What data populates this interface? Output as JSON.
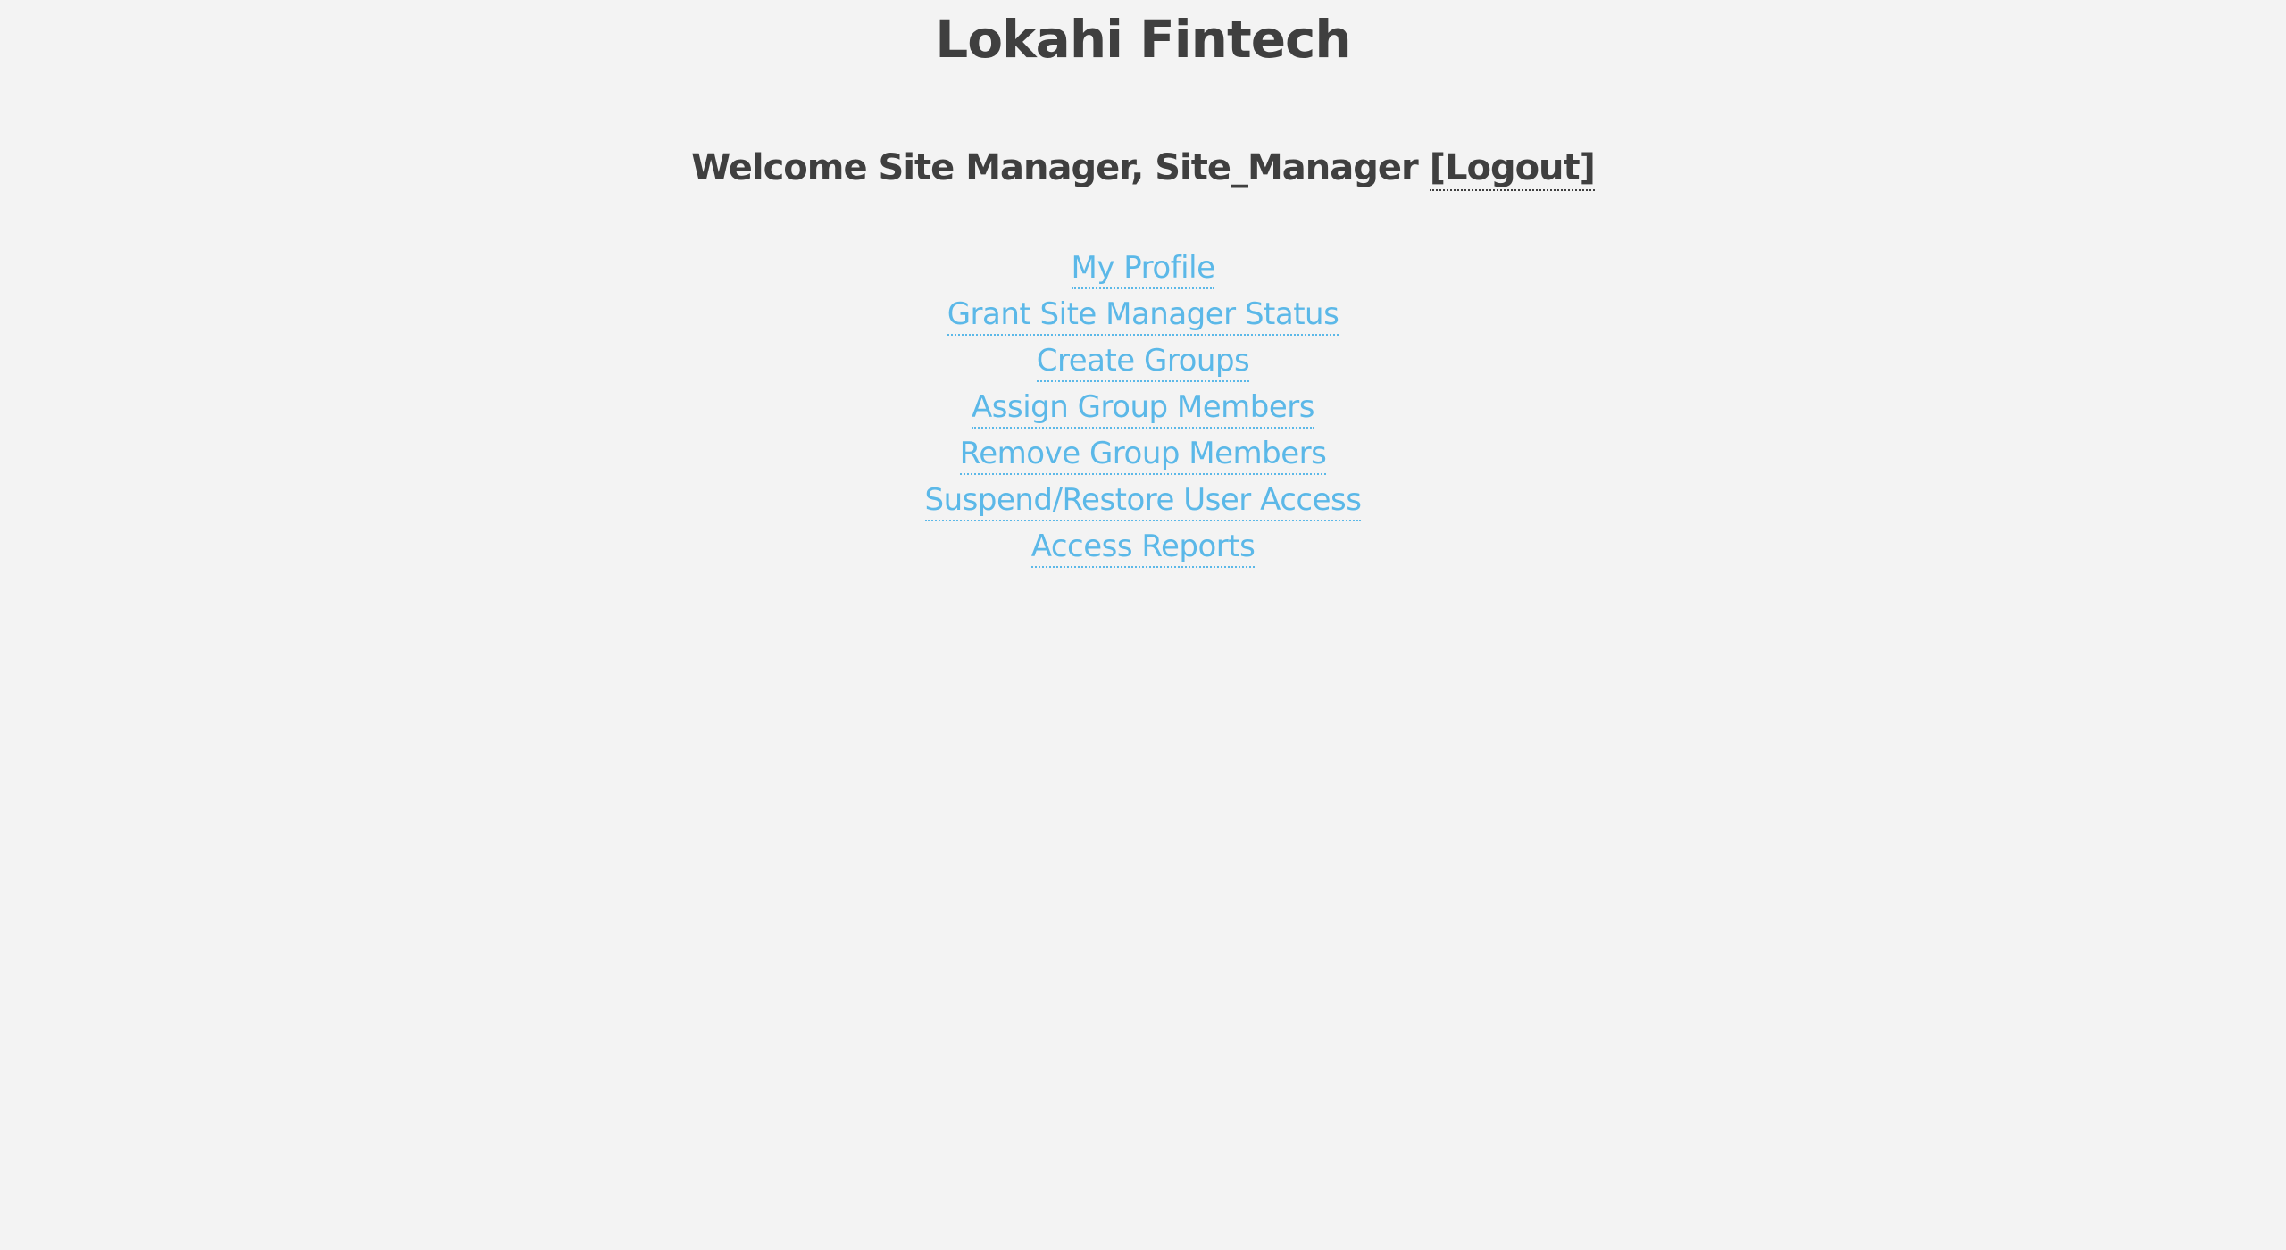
{
  "header": {
    "title": "Lokahi Fintech"
  },
  "welcome": {
    "text": "Welcome Site Manager, Site_Manager",
    "logout_label": "[Logout]"
  },
  "menu": {
    "items": [
      {
        "label": "My Profile"
      },
      {
        "label": "Grant Site Manager Status"
      },
      {
        "label": "Create Groups"
      },
      {
        "label": "Assign Group Members"
      },
      {
        "label": "Remove Group Members"
      },
      {
        "label": "Suspend/Restore User Access"
      },
      {
        "label": "Access Reports"
      }
    ]
  },
  "colors": {
    "background": "#f3f3f3",
    "text": "#3f3f3f",
    "link": "#5bb8e8"
  }
}
